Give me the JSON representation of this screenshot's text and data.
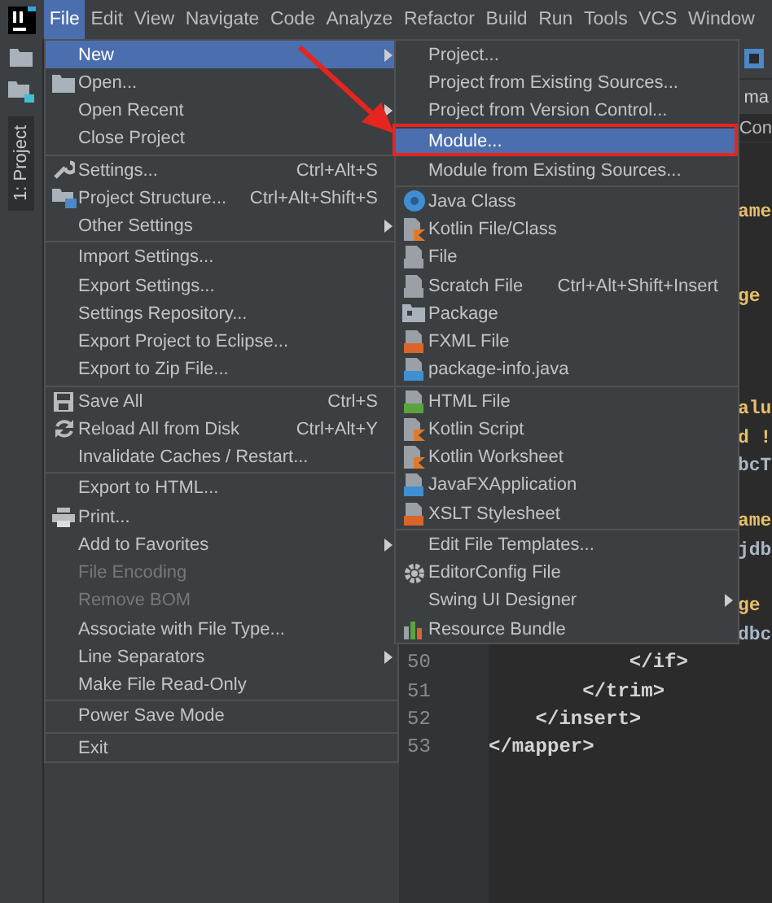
{
  "menu_bar": [
    {
      "label": "File",
      "selected": true
    },
    {
      "label": "Edit",
      "selected": false
    },
    {
      "label": "View",
      "selected": false
    },
    {
      "label": "Navigate",
      "selected": false
    },
    {
      "label": "Code",
      "selected": false
    },
    {
      "label": "Analyze",
      "selected": false
    },
    {
      "label": "Refactor",
      "selected": false
    },
    {
      "label": "Build",
      "selected": false
    },
    {
      "label": "Run",
      "selected": false
    },
    {
      "label": "Tools",
      "selected": false
    },
    {
      "label": "VCS",
      "selected": false
    },
    {
      "label": "Window",
      "selected": false
    }
  ],
  "tool_window_tab": {
    "label": "1: Project",
    "selected": true
  },
  "file_menu": [
    {
      "kind": "item",
      "label": "New",
      "submenu": true,
      "disabled": false,
      "selected": true
    },
    {
      "kind": "item",
      "label": "Open...",
      "submenu": false,
      "disabled": false,
      "selected": false
    },
    {
      "kind": "item",
      "label": "Open Recent",
      "submenu": true,
      "disabled": false,
      "selected": false
    },
    {
      "kind": "item",
      "label": "Close Project",
      "submenu": false,
      "disabled": false,
      "selected": false
    },
    {
      "kind": "separator"
    },
    {
      "kind": "item",
      "label": "Settings...",
      "shortcut": "Ctrl+Alt+S",
      "submenu": false,
      "disabled": false,
      "selected": false
    },
    {
      "kind": "item",
      "label": "Project Structure...",
      "shortcut": "Ctrl+Alt+Shift+S",
      "submenu": false,
      "disabled": false,
      "selected": false
    },
    {
      "kind": "item",
      "label": "Other Settings",
      "submenu": true,
      "disabled": false,
      "selected": false
    },
    {
      "kind": "separator"
    },
    {
      "kind": "item",
      "label": "Import Settings...",
      "submenu": false,
      "disabled": false,
      "selected": false
    },
    {
      "kind": "item",
      "label": "Export Settings...",
      "submenu": false,
      "disabled": false,
      "selected": false
    },
    {
      "kind": "item",
      "label": "Settings Repository...",
      "submenu": false,
      "disabled": false,
      "selected": false
    },
    {
      "kind": "item",
      "label": "Export Project to Eclipse...",
      "submenu": false,
      "disabled": false,
      "selected": false
    },
    {
      "kind": "item",
      "label": "Export to Zip File...",
      "submenu": false,
      "disabled": false,
      "selected": false
    },
    {
      "kind": "separator"
    },
    {
      "kind": "item",
      "label": "Save All",
      "shortcut": "Ctrl+S",
      "submenu": false,
      "disabled": false,
      "selected": false
    },
    {
      "kind": "item",
      "label": "Reload All from Disk",
      "shortcut": "Ctrl+Alt+Y",
      "submenu": false,
      "disabled": false,
      "selected": false
    },
    {
      "kind": "item",
      "label": "Invalidate Caches / Restart...",
      "submenu": false,
      "disabled": false,
      "selected": false
    },
    {
      "kind": "separator"
    },
    {
      "kind": "item",
      "label": "Export to HTML...",
      "submenu": false,
      "disabled": false,
      "selected": false
    },
    {
      "kind": "item",
      "label": "Print...",
      "submenu": false,
      "disabled": false,
      "selected": false
    },
    {
      "kind": "item",
      "label": "Add to Favorites",
      "submenu": true,
      "disabled": false,
      "selected": false
    },
    {
      "kind": "item",
      "label": "File Encoding",
      "submenu": false,
      "disabled": true,
      "selected": false
    },
    {
      "kind": "item",
      "label": "Remove BOM",
      "submenu": false,
      "disabled": true,
      "selected": false
    },
    {
      "kind": "item",
      "label": "Associate with File Type...",
      "submenu": false,
      "disabled": false,
      "selected": false
    },
    {
      "kind": "item",
      "label": "Line Separators",
      "submenu": true,
      "disabled": false,
      "selected": false
    },
    {
      "kind": "item",
      "label": "Make File Read-Only",
      "submenu": false,
      "disabled": false,
      "selected": false
    },
    {
      "kind": "separator"
    },
    {
      "kind": "item",
      "label": "Power Save Mode",
      "submenu": false,
      "disabled": false,
      "selected": false
    },
    {
      "kind": "separator"
    },
    {
      "kind": "item",
      "label": "Exit",
      "submenu": false,
      "disabled": false,
      "selected": false
    }
  ],
  "new_submenu": [
    {
      "kind": "item",
      "label": "Project...",
      "submenu": false,
      "disabled": false,
      "selected": false
    },
    {
      "kind": "item",
      "label": "Project from Existing Sources...",
      "submenu": false,
      "disabled": false,
      "selected": false
    },
    {
      "kind": "item",
      "label": "Project from Version Control...",
      "submenu": false,
      "disabled": false,
      "selected": false
    },
    {
      "kind": "separator"
    },
    {
      "kind": "item",
      "label": "Module...",
      "submenu": false,
      "disabled": false,
      "selected": true
    },
    {
      "kind": "item",
      "label": "Module from Existing Sources...",
      "submenu": false,
      "disabled": false,
      "selected": false
    },
    {
      "kind": "separator"
    },
    {
      "kind": "item",
      "label": "Java Class",
      "submenu": false,
      "disabled": false,
      "selected": false
    },
    {
      "kind": "item",
      "label": "Kotlin File/Class",
      "submenu": false,
      "disabled": false,
      "selected": false
    },
    {
      "kind": "item",
      "label": "File",
      "submenu": false,
      "disabled": false,
      "selected": false
    },
    {
      "kind": "item",
      "label": "Scratch File",
      "shortcut": "Ctrl+Alt+Shift+Insert",
      "submenu": false,
      "disabled": false,
      "selected": false
    },
    {
      "kind": "item",
      "label": "Package",
      "submenu": false,
      "disabled": false,
      "selected": false
    },
    {
      "kind": "item",
      "label": "FXML File",
      "submenu": false,
      "disabled": false,
      "selected": false
    },
    {
      "kind": "item",
      "label": "package-info.java",
      "submenu": false,
      "disabled": false,
      "selected": false
    },
    {
      "kind": "separator"
    },
    {
      "kind": "item",
      "label": "HTML File",
      "submenu": false,
      "disabled": false,
      "selected": false
    },
    {
      "kind": "item",
      "label": "Kotlin Script",
      "submenu": false,
      "disabled": false,
      "selected": false
    },
    {
      "kind": "item",
      "label": "Kotlin Worksheet",
      "submenu": false,
      "disabled": false,
      "selected": false
    },
    {
      "kind": "item",
      "label": "JavaFXApplication",
      "submenu": false,
      "disabled": false,
      "selected": false
    },
    {
      "kind": "item",
      "label": "XSLT Stylesheet",
      "submenu": false,
      "disabled": false,
      "selected": false
    },
    {
      "kind": "separator"
    },
    {
      "kind": "item",
      "label": "Edit File Templates...",
      "submenu": false,
      "disabled": false,
      "selected": false
    },
    {
      "kind": "item",
      "label": "EditorConfig File",
      "submenu": false,
      "disabled": false,
      "selected": false
    },
    {
      "kind": "item",
      "label": "Swing UI Designer",
      "submenu": true,
      "disabled": false,
      "selected": false
    },
    {
      "kind": "item",
      "label": "Resource Bundle",
      "submenu": false,
      "disabled": false,
      "selected": false
    }
  ],
  "editor": {
    "tab": "ma",
    "breadcrumb": "Con",
    "rows": [
      {
        "kind": "fragment",
        "text": "ame",
        "color": "#e8bf6a"
      },
      {
        "kind": "blank"
      },
      {
        "kind": "blank"
      },
      {
        "kind": "fragment",
        "text": "ge",
        "color": "#e8bf6a"
      },
      {
        "kind": "blank"
      },
      {
        "kind": "blank"
      },
      {
        "kind": "blank"
      },
      {
        "kind": "fragment",
        "text": "alu",
        "color": "#e8bf6a"
      },
      {
        "kind": "fragment",
        "text": "d !",
        "color": "#e8bf6a"
      },
      {
        "kind": "fragment",
        "text": "bcT",
        "color": "#a9b7c6"
      },
      {
        "kind": "blank"
      },
      {
        "kind": "fragment",
        "text": "ame",
        "color": "#e8bf6a"
      },
      {
        "kind": "fragment",
        "text": "jdb",
        "color": "#a9b7c6"
      },
      {
        "kind": "blank"
      },
      {
        "kind": "fragment",
        "text": "ge",
        "color": "#e8bf6a"
      },
      {
        "kind": "fragment",
        "text": "dbc",
        "color": "#a9b7c6"
      },
      {
        "kind": "line",
        "number": "50",
        "text": "            </if>"
      },
      {
        "kind": "line",
        "number": "51",
        "text": "        </trim>"
      },
      {
        "kind": "line",
        "number": "52",
        "text": "    </insert>"
      },
      {
        "kind": "line",
        "number": "53",
        "text": "</mapper>"
      }
    ]
  }
}
